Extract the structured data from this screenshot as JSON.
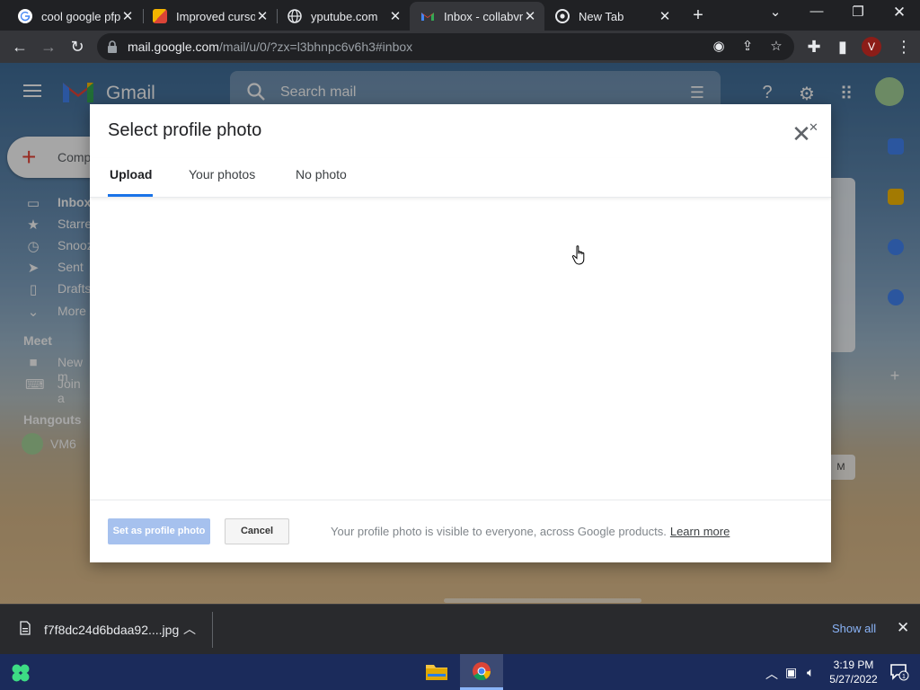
{
  "browser": {
    "tabs": [
      {
        "title": "cool google pfp",
        "active": false,
        "favicon": "google-g-icon"
      },
      {
        "title": "Improved curso",
        "active": false,
        "favicon": "colorful-square-icon"
      },
      {
        "title": "yputube.com",
        "active": false,
        "favicon": "globe-icon"
      },
      {
        "title": "Inbox - collabvm",
        "active": true,
        "favicon": "gmail-icon"
      },
      {
        "title": "New Tab",
        "active": false,
        "favicon": "chrome-icon"
      }
    ],
    "url_host": "mail.google.com",
    "url_path": "/mail/u/0/?zx=l3bhnpc6v6h3#inbox",
    "profile_initial": "V"
  },
  "gmail": {
    "product_name": "Gmail",
    "search_placeholder": "Search mail",
    "compose_label": "Comp",
    "nav": [
      {
        "label": "Inbox",
        "icon": "inbox-icon",
        "bold": true
      },
      {
        "label": "Starre",
        "icon": "star-icon",
        "bold": false
      },
      {
        "label": "Snooz",
        "icon": "clock-icon",
        "bold": false
      },
      {
        "label": "Sent",
        "icon": "send-icon",
        "bold": false
      },
      {
        "label": "Drafts",
        "icon": "draft-icon",
        "bold": false
      },
      {
        "label": "More",
        "icon": "chevron-down-icon",
        "bold": false
      }
    ],
    "meet": {
      "heading": "Meet",
      "items": [
        {
          "label": "New m",
          "icon": "video-icon"
        },
        {
          "label": "Join a",
          "icon": "keyboard-icon"
        }
      ]
    },
    "hangouts": {
      "heading": "Hangouts",
      "user": "VM6"
    },
    "side_chip": "M"
  },
  "modal": {
    "title": "Select profile photo",
    "tabs": [
      {
        "label": "Upload",
        "active": true
      },
      {
        "label": "Your photos",
        "active": false
      },
      {
        "label": "No photo",
        "active": false
      }
    ],
    "primary_button": "Set as profile photo",
    "cancel_button": "Cancel",
    "footer_note": "Your profile photo is visible to everyone, across Google products.",
    "learn_more": "Learn more"
  },
  "downloads": {
    "file_name": "f7f8dc24d6bdaa92....jpg",
    "show_all": "Show all"
  },
  "taskbar": {
    "time": "3:19 PM",
    "date": "5/27/2022",
    "notification_count": "1"
  },
  "colors": {
    "accent_blue": "#1a73e8",
    "disabled_primary": "#a6c1ee",
    "chrome_dark": "#202124",
    "taskbar": "#1b2b5b"
  }
}
